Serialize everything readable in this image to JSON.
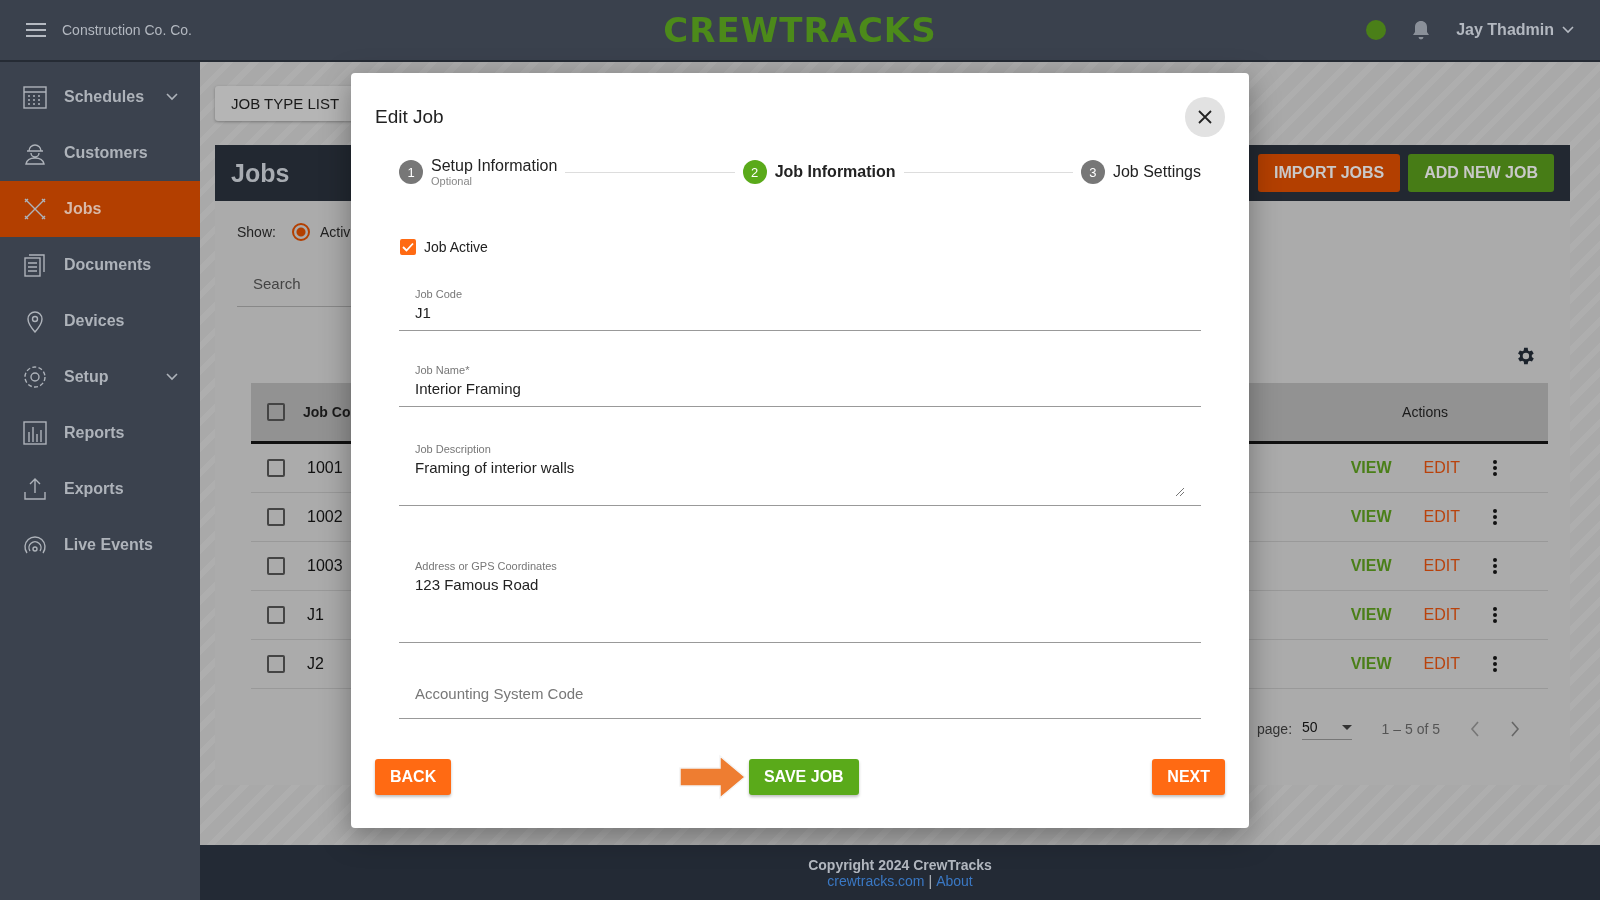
{
  "topbar": {
    "company": "Construction Co. Co.",
    "logo": "CREWTRACKS",
    "user": "Jay Thadmin"
  },
  "sidebar": {
    "items": [
      {
        "label": "Schedules",
        "kind": "calendar",
        "expandable": true,
        "selected": false
      },
      {
        "label": "Customers",
        "kind": "worker",
        "expandable": false,
        "selected": false
      },
      {
        "label": "Jobs",
        "kind": "tools",
        "expandable": false,
        "selected": true
      },
      {
        "label": "Documents",
        "kind": "documents",
        "expandable": false,
        "selected": false
      },
      {
        "label": "Devices",
        "kind": "pin",
        "expandable": false,
        "selected": false
      },
      {
        "label": "Setup",
        "kind": "gear",
        "expandable": true,
        "selected": false
      },
      {
        "label": "Reports",
        "kind": "chart",
        "expandable": false,
        "selected": false
      },
      {
        "label": "Exports",
        "kind": "upload",
        "expandable": false,
        "selected": false
      },
      {
        "label": "Live Events",
        "kind": "signal",
        "expandable": false,
        "selected": false
      }
    ]
  },
  "page": {
    "job_type_button": "JOB TYPE LIST",
    "title": "Jobs",
    "import_button": "IMPORT JOBS",
    "add_button": "ADD NEW JOB",
    "show_label": "Show:",
    "show_option": {
      "label": "Activ",
      "selected": true
    },
    "search": {
      "placeholder": "Search"
    },
    "table": {
      "header_checked": false,
      "columns": [
        "Job Co",
        "Actions"
      ],
      "rows": [
        {
          "code": "1001",
          "checked": false,
          "view": "VIEW",
          "edit": "EDIT"
        },
        {
          "code": "1002",
          "checked": false,
          "view": "VIEW",
          "edit": "EDIT"
        },
        {
          "code": "1003",
          "checked": false,
          "view": "VIEW",
          "edit": "EDIT"
        },
        {
          "code": "J1",
          "checked": false,
          "view": "VIEW",
          "edit": "EDIT"
        },
        {
          "code": "J2",
          "checked": false,
          "view": "VIEW",
          "edit": "EDIT"
        }
      ]
    },
    "pagination": {
      "per_page_label": "page:",
      "per_page": "50",
      "range": "1 – 5 of 5"
    }
  },
  "modal": {
    "title": "Edit Job",
    "steps": [
      {
        "number": "1",
        "label": "Setup Information",
        "sublabel": "Optional",
        "selected": false
      },
      {
        "number": "2",
        "label": "Job Information",
        "selected": true
      },
      {
        "number": "3",
        "label": "Job Settings",
        "selected": false
      }
    ],
    "job_active": {
      "label": "Job Active",
      "checked": true
    },
    "fields": [
      {
        "kind": "text",
        "label": "Job Code",
        "value": "J1"
      },
      {
        "kind": "text",
        "label": "Job Name*",
        "value": "Interior Framing"
      },
      {
        "kind": "textarea",
        "label": "Job Description",
        "value": "Framing of interior walls"
      },
      {
        "kind": "tall",
        "label": "Address or GPS Coordinates",
        "value": "123 Famous Road"
      },
      {
        "kind": "empty",
        "placeholder": "Accounting System Code"
      }
    ],
    "buttons": {
      "back": "BACK",
      "save": "SAVE JOB",
      "next": "NEXT"
    }
  },
  "footer": {
    "copyright": "Copyright 2024 CrewTracks",
    "link": "crewtracks.com",
    "separator": "|",
    "about": "About"
  }
}
